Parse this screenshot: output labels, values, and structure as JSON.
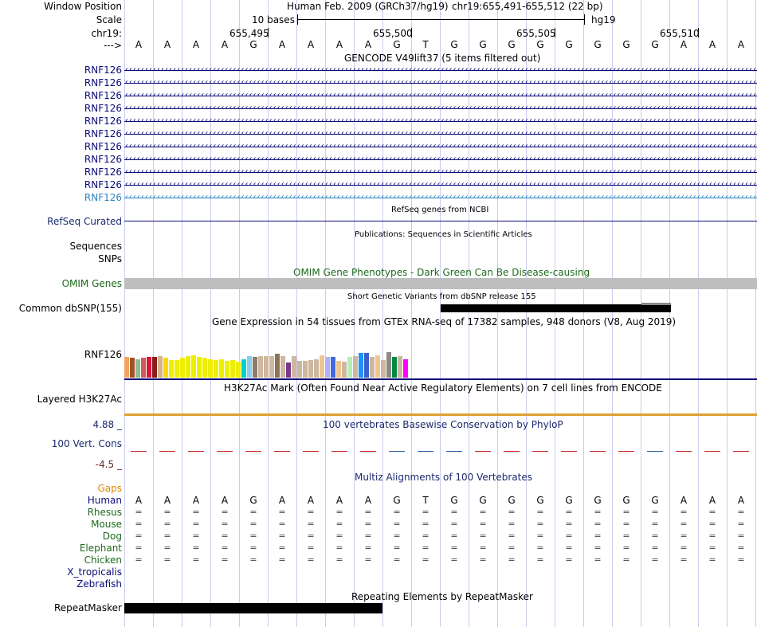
{
  "header": {
    "assembly": "Human Feb. 2009 (GRCh37/hg19)",
    "position": "chr19:655,491-655,512 (22 bp)",
    "scale_text": "10 bases",
    "db": "hg19"
  },
  "labels": {
    "window_position": "Window Position",
    "scale": "Scale",
    "chrom": "chr19:",
    "strand": "--->",
    "refseq": "RefSeq Curated",
    "sequences": "Sequences",
    "snps": "SNPs",
    "omim": "OMIM Genes",
    "dbsnp": "Common dbSNP(155)",
    "gtex_gene": "RNF126",
    "h3k27ac": "Layered H3K27Ac",
    "phylop_max": "4.88 _",
    "phylop_name": "100 Vert. Cons",
    "phylop_min": "-4.5 _",
    "gaps": "Gaps",
    "repeatmasker": "RepeatMasker"
  },
  "coords": [
    "655,495",
    "655,500",
    "655,505",
    "655,510"
  ],
  "sequence": [
    "A",
    "A",
    "A",
    "A",
    "G",
    "A",
    "A",
    "A",
    "A",
    "G",
    "T",
    "G",
    "G",
    "G",
    "G",
    "G",
    "G",
    "G",
    "G",
    "A",
    "A",
    "A"
  ],
  "tracks": {
    "gencode_title": "GENCODE V49lift37 (5 items filtered out)",
    "gencode_items": [
      "RNF126",
      "RNF126",
      "RNF126",
      "RNF126",
      "RNF126",
      "RNF126",
      "RNF126",
      "RNF126",
      "RNF126",
      "RNF126",
      "RNF126"
    ],
    "refseq_title": "RefSeq genes from NCBI",
    "pubs_title": "Publications: Sequences in Scientific Articles",
    "omim_title": "OMIM Gene Phenotypes - Dark Green Can Be Disease-causing",
    "dbsnp_title": "Short Genetic Variants from dbSNP release 155",
    "gtex_title": "Gene Expression in 54 tissues from GTEx RNA-seq of 17382 samples, 948 donors (V8, Aug 2019)",
    "h3k27ac_title": "H3K27Ac Mark (Often Found Near Active Regulatory Elements) on 7 cell lines from ENCODE",
    "phylop_title": "100 vertebrates Basewise Conservation by PhyloP",
    "multiz_title": "Multiz Alignments of 100 Vertebrates",
    "rmsk_title": "Repeating Elements by RepeatMasker"
  },
  "species": [
    {
      "name": "Human",
      "seq": [
        "A",
        "A",
        "A",
        "A",
        "G",
        "A",
        "A",
        "A",
        "A",
        "G",
        "T",
        "G",
        "G",
        "G",
        "G",
        "G",
        "G",
        "G",
        "G",
        "A",
        "A",
        "A"
      ]
    },
    {
      "name": "Rhesus",
      "seq": [
        "=",
        "=",
        "=",
        "=",
        "=",
        "=",
        "=",
        "=",
        "=",
        "=",
        "=",
        "=",
        "=",
        "=",
        "=",
        "=",
        "=",
        "=",
        "=",
        "=",
        "=",
        "="
      ]
    },
    {
      "name": "Mouse",
      "seq": [
        "=",
        "=",
        "=",
        "=",
        "=",
        "=",
        "=",
        "=",
        "=",
        "=",
        "=",
        "=",
        "=",
        "=",
        "=",
        "=",
        "=",
        "=",
        "=",
        "=",
        "=",
        "="
      ]
    },
    {
      "name": "Dog",
      "seq": [
        "=",
        "=",
        "=",
        "=",
        "=",
        "=",
        "=",
        "=",
        "=",
        "=",
        "=",
        "=",
        "=",
        "=",
        "=",
        "=",
        "=",
        "=",
        "=",
        "=",
        "=",
        "="
      ]
    },
    {
      "name": "Elephant",
      "seq": [
        "=",
        "=",
        "=",
        "=",
        "=",
        "=",
        "=",
        "=",
        "=",
        "=",
        "=",
        "=",
        "=",
        "=",
        "=",
        "=",
        "=",
        "=",
        "=",
        "=",
        "=",
        "="
      ]
    },
    {
      "name": "Chicken",
      "seq": [
        "=",
        "=",
        "=",
        "=",
        "=",
        "=",
        "=",
        "=",
        "=",
        "=",
        "=",
        "=",
        "=",
        "=",
        "=",
        "=",
        "=",
        "=",
        "=",
        "=",
        "=",
        "="
      ]
    },
    {
      "name": "X_tropicalis",
      "seq": []
    },
    {
      "name": "Zebrafish",
      "seq": []
    }
  ],
  "gtex_colors": [
    "#f4a460",
    "#a0522d",
    "#8fbc8f",
    "#cd5c5c",
    "#dc143c",
    "#8b1a1a",
    "#d2b48c",
    "#ffd700",
    "#eeee00",
    "#eeee00",
    "#eeee00",
    "#eeee00",
    "#eeee00",
    "#eeee00",
    "#eeee00",
    "#eeee00",
    "#eeee00",
    "#eeee00",
    "#eeee00",
    "#eeee00",
    "#eeee00",
    "#00ced1",
    "#87ceeb",
    "#8b7d6b",
    "#cdb79e",
    "#cdb79e",
    "#cdb79e",
    "#8b7355",
    "#cdb79e",
    "#7a378b",
    "#cdb79e",
    "#cdb79e",
    "#cdb79e",
    "#cdb79e",
    "#cdb79e",
    "#eec591",
    "#b0b0ff",
    "#4169e1",
    "#eec591",
    "#cdb79e",
    "#b4eeb4",
    "#cdb79e",
    "#1e90ff",
    "#3a5fcd",
    "#cdb79e",
    "#eec591",
    "#cdb79e",
    "#8b8b83",
    "#008b45",
    "#cdb79e",
    "#ff00ff"
  ],
  "gtex_values": [
    0.48,
    0.46,
    0.44,
    0.46,
    0.48,
    0.48,
    0.5,
    0.46,
    0.42,
    0.42,
    0.46,
    0.5,
    0.52,
    0.48,
    0.46,
    0.44,
    0.42,
    0.44,
    0.4,
    0.42,
    0.38,
    0.44,
    0.5,
    0.48,
    0.5,
    0.5,
    0.5,
    0.56,
    0.5,
    0.36,
    0.5,
    0.4,
    0.4,
    0.42,
    0.44,
    0.52,
    0.48,
    0.48,
    0.4,
    0.38,
    0.48,
    0.5,
    0.58,
    0.58,
    0.48,
    0.52,
    0.42,
    0.6,
    0.48,
    0.5,
    0.44
  ],
  "colors": {
    "omim_bar": "#bebebe",
    "gencode": "#0c0c78",
    "gencode_highlight": "#2e86c1",
    "h3k27ac": "#e0a030",
    "phylop_neg": "#cc2222",
    "phylop_pos": "#2b5fa8"
  }
}
